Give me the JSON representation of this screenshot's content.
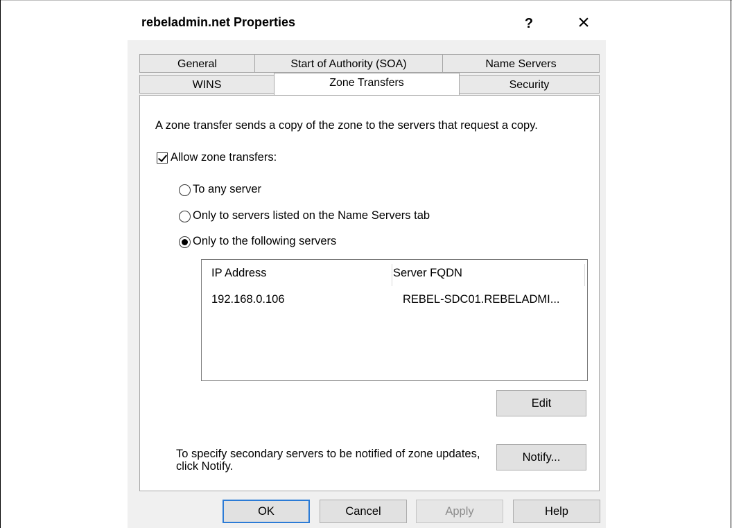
{
  "window": {
    "title": "rebeladmin.net Properties",
    "help_label": "?",
    "close_label": "×"
  },
  "tabs": {
    "row1": [
      "General",
      "Start of Authority (SOA)",
      "Name Servers"
    ],
    "row2": [
      "WINS",
      "Zone Transfers",
      "Security"
    ],
    "active": "Zone Transfers"
  },
  "panel": {
    "description": "A zone transfer sends a copy of the zone to the servers that request a copy.",
    "allow_checkbox": {
      "label": "Allow zone transfers:",
      "checked": true
    },
    "radios": [
      {
        "label": "To any server",
        "selected": false
      },
      {
        "label": "Only to servers listed on the Name Servers tab",
        "selected": false
      },
      {
        "label": "Only to the following servers",
        "selected": true
      }
    ],
    "server_list": {
      "columns": [
        "IP Address",
        "Server FQDN"
      ],
      "rows": [
        {
          "ip": "192.168.0.106",
          "fqdn": "REBEL-SDC01.REBELADMI..."
        }
      ]
    },
    "edit_label": "Edit",
    "notify_text": "To specify secondary servers to be notified of zone updates, click Notify.",
    "notify_label": "Notify..."
  },
  "footer": {
    "ok_label": "OK",
    "cancel_label": "Cancel",
    "apply_label": "Apply",
    "help_label": "Help"
  },
  "colors": {
    "dialog_bg": "#f0f0f0",
    "default_button_border": "#2b7bd6"
  }
}
